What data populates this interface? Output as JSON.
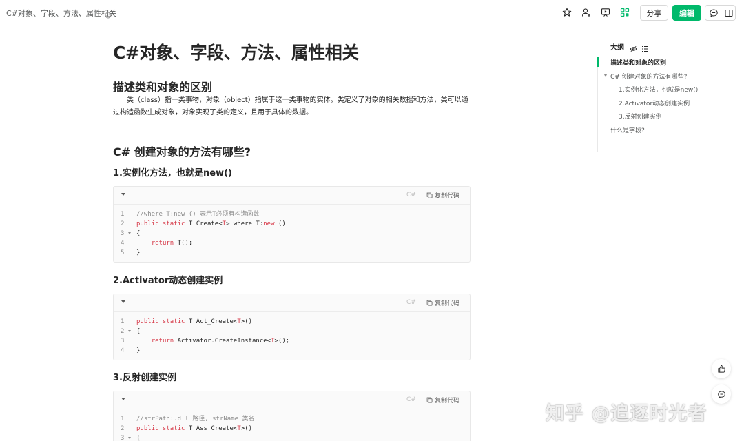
{
  "topbar": {
    "doc_title": "C#对象、字段、方法、属性相关",
    "share_label": "分享",
    "edit_label": "编辑"
  },
  "colors": {
    "accent": "#00b96b",
    "keyword": "#d73a49",
    "comment": "#8b8b8b"
  },
  "article": {
    "title": "C#对象、字段、方法、属性相关",
    "section1_heading": "描述类和对象的区别",
    "section1_para": "类（class）指一类事物，对象（object）指属于这一类事物的实体。类定义了对象的相关数据和方法，类可以通过构造函数生成对象，对象实现了类的定义，且用于具体的数据。",
    "section2_heading": "C# 创建对象的方法有哪些?",
    "sub1_heading": "1.实例化方法，也就是new()",
    "sub2_heading": "2.Activator动态创建实例",
    "sub3_heading": "3.反射创建实例"
  },
  "code_blocks": [
    {
      "lang": "C#",
      "copy_label": "复制代码",
      "lines": [
        {
          "num": "1",
          "fold": false,
          "indent": "",
          "parts": [
            {
              "t": "//where T:new () 表示T必须有构造函数",
              "c": "c"
            }
          ]
        },
        {
          "num": "2",
          "fold": false,
          "indent": "",
          "parts": [
            {
              "t": "public static",
              "c": "k"
            },
            {
              "t": " T Create<",
              "c": ""
            },
            {
              "t": "T",
              "c": "k"
            },
            {
              "t": "> where T:",
              "c": ""
            },
            {
              "t": "new",
              "c": "k"
            },
            {
              "t": " ()",
              "c": ""
            }
          ]
        },
        {
          "num": "3",
          "fold": true,
          "indent": "",
          "parts": [
            {
              "t": "{",
              "c": ""
            }
          ]
        },
        {
          "num": "4",
          "fold": false,
          "indent": "    ",
          "parts": [
            {
              "t": "return",
              "c": "k"
            },
            {
              "t": " T();",
              "c": ""
            }
          ]
        },
        {
          "num": "5",
          "fold": false,
          "indent": "",
          "parts": [
            {
              "t": "}",
              "c": ""
            }
          ]
        }
      ]
    },
    {
      "lang": "C#",
      "copy_label": "复制代码",
      "lines": [
        {
          "num": "1",
          "fold": false,
          "indent": "",
          "parts": [
            {
              "t": "public static",
              "c": "k"
            },
            {
              "t": " T Act_Create<",
              "c": ""
            },
            {
              "t": "T",
              "c": "k"
            },
            {
              "t": ">()",
              "c": ""
            }
          ]
        },
        {
          "num": "2",
          "fold": true,
          "indent": "",
          "parts": [
            {
              "t": "{",
              "c": ""
            }
          ]
        },
        {
          "num": "3",
          "fold": false,
          "indent": "    ",
          "parts": [
            {
              "t": "return",
              "c": "k"
            },
            {
              "t": " Activator.CreateInstance<",
              "c": ""
            },
            {
              "t": "T",
              "c": "k"
            },
            {
              "t": ">();",
              "c": ""
            }
          ]
        },
        {
          "num": "4",
          "fold": false,
          "indent": "",
          "parts": [
            {
              "t": "}",
              "c": ""
            }
          ]
        }
      ]
    },
    {
      "lang": "C#",
      "copy_label": "复制代码",
      "lines": [
        {
          "num": "1",
          "fold": false,
          "indent": "",
          "parts": [
            {
              "t": "//strPath:.dll 路径, strName 类名",
              "c": "c"
            }
          ]
        },
        {
          "num": "2",
          "fold": false,
          "indent": "",
          "parts": [
            {
              "t": "public static",
              "c": "k"
            },
            {
              "t": " T Ass_Create<",
              "c": ""
            },
            {
              "t": "T",
              "c": "k"
            },
            {
              "t": ">()",
              "c": ""
            }
          ]
        },
        {
          "num": "3",
          "fold": true,
          "indent": "",
          "parts": [
            {
              "t": "{",
              "c": ""
            }
          ]
        }
      ]
    }
  ],
  "outline": {
    "title": "大纲",
    "items": [
      "描述类和对象的区别",
      "C# 创建对象的方法有哪些?",
      "1.实例化方法，也就是new()",
      "2.Activator动态创建实例",
      "3.反射创建实例",
      "什么是字段?"
    ]
  },
  "watermark": "知乎 @追逐时光者"
}
